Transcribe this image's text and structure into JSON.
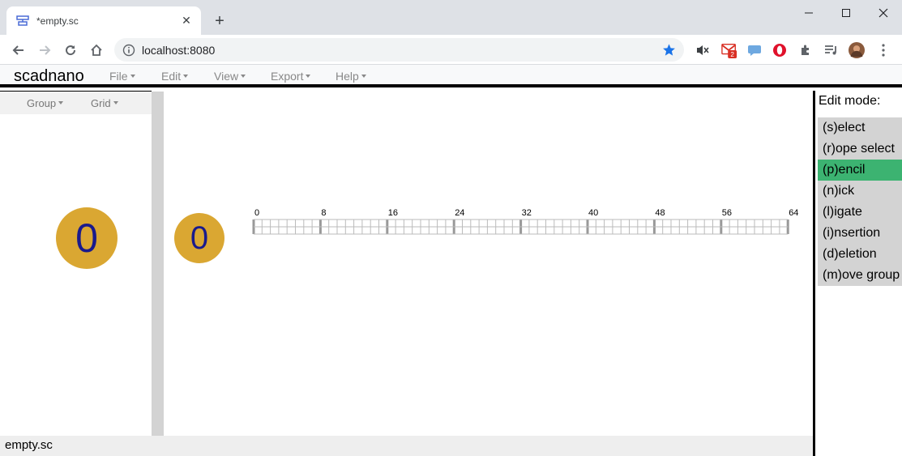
{
  "browser": {
    "tab_title": "*empty.sc",
    "url": "localhost:8080",
    "gmail_badge": "2"
  },
  "app": {
    "name": "scadnano",
    "menus": [
      "File",
      "Edit",
      "View",
      "Export",
      "Help"
    ]
  },
  "side_panel": {
    "menus": [
      "Group",
      "Grid"
    ],
    "helix_label": "0"
  },
  "main_view": {
    "helix_label": "0",
    "ticks": [
      "0",
      "8",
      "16",
      "24",
      "32",
      "40",
      "48",
      "56",
      "64"
    ],
    "base_count": 64
  },
  "edit_modes": {
    "label": "Edit mode:",
    "items": [
      {
        "label": "(s)elect",
        "active": false
      },
      {
        "label": "(r)ope select",
        "active": false
      },
      {
        "label": "(p)encil",
        "active": true
      },
      {
        "label": "(n)ick",
        "active": false
      },
      {
        "label": "(l)igate",
        "active": false
      },
      {
        "label": "(i)nsertion",
        "active": false
      },
      {
        "label": "(d)eletion",
        "active": false
      },
      {
        "label": "(m)ove group",
        "active": false
      }
    ]
  },
  "status": {
    "filename": "empty.sc"
  },
  "colors": {
    "helix_fill": "#daa732",
    "helix_text": "#1a1a8c",
    "active_mode": "#3cb371",
    "inactive_mode": "#d3d3d3"
  }
}
